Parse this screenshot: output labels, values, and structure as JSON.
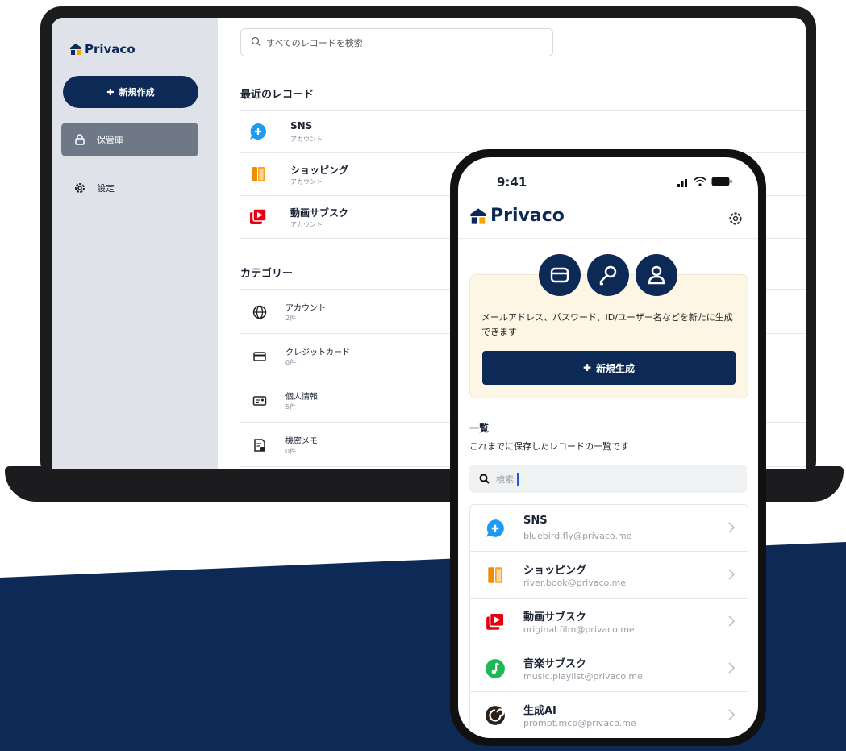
{
  "brand": {
    "name": "Privaco",
    "navy": "#0d2a57"
  },
  "desktop": {
    "search_placeholder": "すべてのレコードを検索",
    "new_button": "新規作成",
    "nav": [
      {
        "label": "保管庫",
        "icon": "lock-icon",
        "active": true
      },
      {
        "label": "設定",
        "icon": "gear-icon",
        "active": false
      }
    ],
    "recent_title": "最近のレコード",
    "recent": [
      {
        "name": "SNS",
        "sub": "アカウント",
        "icon": "sns-icon"
      },
      {
        "name": "ショッピング",
        "sub": "アカウント",
        "icon": "shopping-icon"
      },
      {
        "name": "動画サブスク",
        "sub": "アカウント",
        "icon": "video-icon"
      }
    ],
    "category_title": "カテゴリー",
    "categories": [
      {
        "name": "アカウント",
        "sub": "2件",
        "icon": "globe-icon"
      },
      {
        "name": "クレジットカード",
        "sub": "0件",
        "icon": "card-icon"
      },
      {
        "name": "個人情報",
        "sub": "5件",
        "icon": "id-card-icon"
      },
      {
        "name": "機密メモ",
        "sub": "0件",
        "icon": "note-icon"
      }
    ]
  },
  "phone": {
    "time": "9:41",
    "generator": {
      "description": "メールアドレス、パスワード、ID/ユーザー名などを新たに生成できます",
      "button": "新規生成"
    },
    "list_title": "一覧",
    "list_description": "これまでに保存したレコードの一覧です",
    "search_placeholder": "検索",
    "records": [
      {
        "name": "SNS",
        "sub": "bluebird.fly@privaco.me",
        "icon": "sns-icon"
      },
      {
        "name": "ショッピング",
        "sub": "river.book@privaco.me",
        "icon": "shopping-icon"
      },
      {
        "name": "動画サブスク",
        "sub": "original.film@privaco.me",
        "icon": "video-icon"
      },
      {
        "name": "音楽サブスク",
        "sub": "music.playlist@privaco.me",
        "icon": "music-icon"
      },
      {
        "name": "生成AI",
        "sub": "prompt.mcp@privaco.me",
        "icon": "ai-icon"
      }
    ]
  }
}
